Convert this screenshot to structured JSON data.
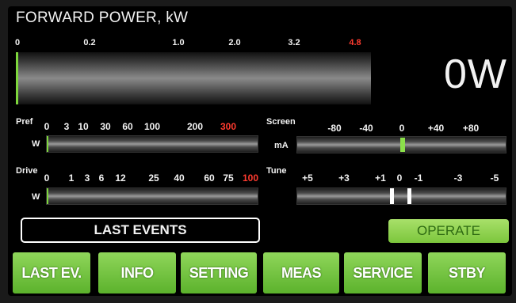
{
  "forward_power": {
    "title": "FORWARD POWER, kW",
    "ticks": [
      "0",
      "0.2",
      "1.0",
      "2.0",
      "3.2",
      "4.8"
    ],
    "value_display": "0W",
    "level": 0
  },
  "pref": {
    "label": "Pref",
    "unit": "W",
    "ticks": [
      "0",
      "3",
      "10",
      "30",
      "60",
      "100",
      "200",
      "300"
    ],
    "level": 0
  },
  "drive": {
    "label": "Drive",
    "unit": "W",
    "ticks": [
      "0",
      "1",
      "3",
      "6",
      "12",
      "25",
      "40",
      "60",
      "75",
      "100"
    ],
    "level": 0
  },
  "screen": {
    "label": "Screen",
    "unit": "mA",
    "ticks": [
      "-80",
      "-40",
      "0",
      "+40",
      "+80"
    ],
    "value": 0
  },
  "tune": {
    "label": "Tune",
    "ticks": [
      "+5",
      "+3",
      "+1",
      "0",
      "-1",
      "-3",
      "-5"
    ]
  },
  "last_events_label": "LAST EVENTS",
  "operate_label": "OPERATE",
  "buttons": {
    "last_ev": "LAST EV.",
    "info": "INFO",
    "setting": "SETTING",
    "meas": "MEAS",
    "service": "SERVICE",
    "stby": "STBY"
  },
  "colors": {
    "accent_green": "#7cc63c",
    "alarm_red": "#ff3b2f"
  }
}
